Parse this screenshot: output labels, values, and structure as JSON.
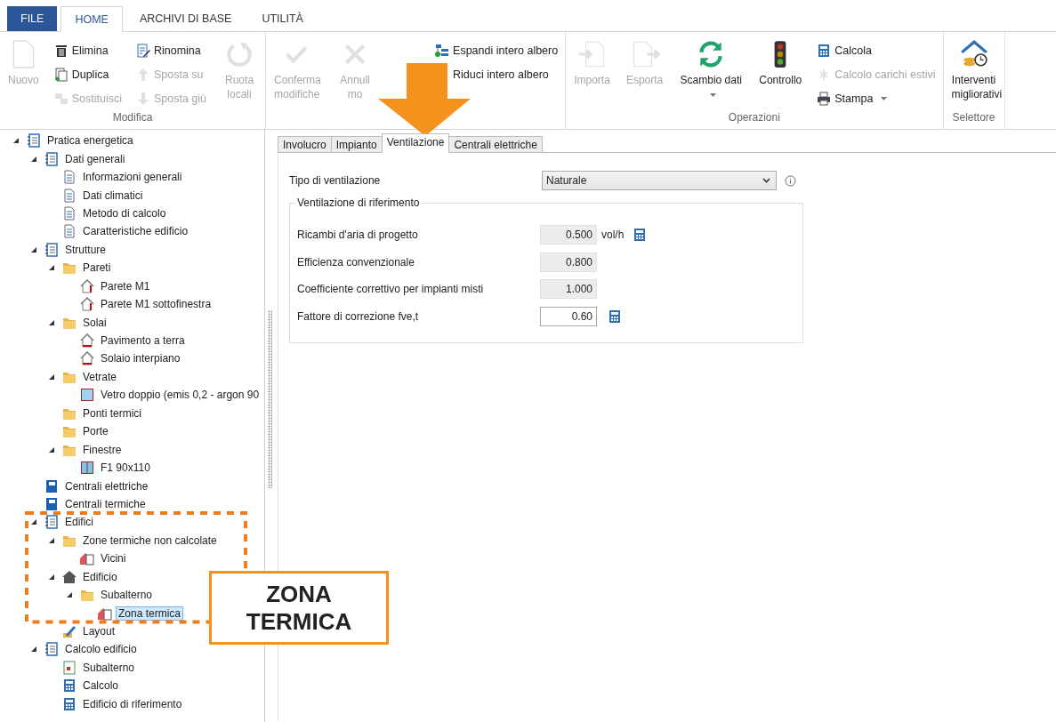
{
  "ribbon": {
    "tabs": [
      {
        "label": "FILE",
        "kind": "file",
        "selected": false
      },
      {
        "label": "HOME",
        "kind": "tab",
        "selected": true
      },
      {
        "label": "ARCHIVI DI BASE",
        "kind": "tab",
        "selected": false
      },
      {
        "label": "UTILITÀ",
        "kind": "tab",
        "selected": false
      }
    ],
    "groups": [
      {
        "label": "Modifica",
        "controls": [
          {
            "label": "Nuovo",
            "kind": "page",
            "disabled": true
          },
          {
            "stack": [
              {
                "label": "Elimina",
                "kind": "trash",
                "disabled": false
              },
              {
                "label": "Duplica",
                "kind": "copy",
                "disabled": false
              },
              {
                "label": "Sostituisci",
                "kind": "swap",
                "disabled": true
              }
            ]
          },
          {
            "stack": [
              {
                "label": "Rinomina",
                "kind": "rename",
                "disabled": false
              },
              {
                "label": "Sposta su",
                "kind": "up",
                "disabled": true
              },
              {
                "label": "Sposta giù",
                "kind": "down",
                "disabled": true
              }
            ]
          },
          {
            "label": "Ruota locali",
            "kind": "rotate",
            "disabled": true
          }
        ]
      },
      {
        "controls": [
          {
            "label": "Conferma modifiche",
            "kind": "check",
            "disabled": true
          },
          {
            "label": "Annull mo",
            "kind": "cross",
            "disabled": true
          },
          {
            "stack": [
              {
                "label": "Espandi intero albero",
                "kind": "tree",
                "disabled": false
              },
              {
                "label": "Riduci intero albero",
                "kind": "none",
                "disabled": false
              }
            ]
          }
        ]
      },
      {
        "label": "Operazioni",
        "controls": [
          {
            "label": "Importa",
            "kind": "import",
            "disabled": true
          },
          {
            "label": "Esporta",
            "kind": "export",
            "disabled": true
          },
          {
            "label": "Scambio dati",
            "kind": "sync",
            "disabled": false,
            "dropdown": true
          },
          {
            "label": "Controllo",
            "kind": "traffic",
            "disabled": false
          },
          {
            "stack": [
              {
                "label": "Calcola",
                "kind": "calc",
                "disabled": false
              },
              {
                "label": "Calcolo carichi estivi",
                "kind": "fan",
                "disabled": true
              },
              {
                "label": "Stampa",
                "kind": "printer",
                "disabled": false,
                "dropdown": true
              }
            ]
          }
        ]
      },
      {
        "label": "Selettore",
        "controls": [
          {
            "label": "Interventi migliorativi",
            "kind": "houseclock",
            "disabled": false
          }
        ]
      }
    ]
  },
  "tree": {
    "items": [
      {
        "label": "Pratica energetica",
        "kind": "notebook",
        "expanded": true,
        "selected": false,
        "children": [
          {
            "label": "Dati generali",
            "kind": "notebook",
            "expanded": true,
            "selected": false,
            "children": [
              {
                "label": "Informazioni generali",
                "kind": "doc",
                "selected": false
              },
              {
                "label": "Dati climatici",
                "kind": "doc",
                "selected": false
              },
              {
                "label": "Metodo di calcolo",
                "kind": "doc",
                "selected": false
              },
              {
                "label": "Caratteristiche edificio",
                "kind": "doc",
                "selected": false
              }
            ]
          },
          {
            "label": "Strutture",
            "kind": "notebook",
            "expanded": true,
            "selected": false,
            "children": [
              {
                "label": "Pareti",
                "kind": "folder",
                "expanded": true,
                "selected": false,
                "children": [
                  {
                    "label": "Parete M1",
                    "kind": "wall",
                    "selected": false
                  },
                  {
                    "label": "Parete M1 sottofinestra",
                    "kind": "wall",
                    "selected": false
                  }
                ]
              },
              {
                "label": "Solai",
                "kind": "folder",
                "expanded": true,
                "selected": false,
                "children": [
                  {
                    "label": "Pavimento a terra",
                    "kind": "floor",
                    "selected": false
                  },
                  {
                    "label": "Solaio interpiano",
                    "kind": "floor",
                    "selected": false
                  }
                ]
              },
              {
                "label": "Vetrate",
                "kind": "folder",
                "expanded": true,
                "selected": false,
                "children": [
                  {
                    "label": "Vetro doppio (emis 0,2 - argon 90",
                    "kind": "glass",
                    "selected": false
                  }
                ]
              },
              {
                "label": "Ponti termici",
                "kind": "folder",
                "selected": false
              },
              {
                "label": "Porte",
                "kind": "folder",
                "selected": false
              },
              {
                "label": "Finestre",
                "kind": "folder",
                "expanded": true,
                "selected": false,
                "children": [
                  {
                    "label": "F1 90x110",
                    "kind": "window",
                    "selected": false
                  }
                ]
              }
            ]
          },
          {
            "label": "Centrali elettriche",
            "kind": "panel",
            "selected": false
          },
          {
            "label": "Centrali termiche",
            "kind": "panel",
            "selected": false
          },
          {
            "label": "Edifici",
            "kind": "notebook",
            "expanded": true,
            "selected": false,
            "children": [
              {
                "label": "Zone termiche non calcolate",
                "kind": "folder",
                "expanded": true,
                "selected": false,
                "children": [
                  {
                    "label": "Vicini",
                    "kind": "zone",
                    "selected": false
                  }
                ]
              },
              {
                "label": "Edificio",
                "kind": "home",
                "expanded": true,
                "selected": false,
                "children": [
                  {
                    "label": "Subalterno",
                    "kind": "folder",
                    "expanded": true,
                    "selected": false,
                    "children": [
                      {
                        "label": "Zona termica",
                        "kind": "zone",
                        "selected": true
                      }
                    ]
                  }
                ]
              },
              {
                "label": "Layout",
                "kind": "pencil",
                "selected": false
              }
            ]
          },
          {
            "label": "Calcolo edificio",
            "kind": "notebook",
            "expanded": true,
            "selected": false,
            "children": [
              {
                "label": "Subalterno",
                "kind": "form",
                "selected": false
              },
              {
                "label": "Calcolo",
                "kind": "calc",
                "selected": false
              },
              {
                "label": "Edificio di riferimento",
                "kind": "calc",
                "selected": false
              }
            ]
          }
        ]
      }
    ]
  },
  "content": {
    "tabs": [
      {
        "label": "Involucro",
        "selected": false
      },
      {
        "label": "Impianto",
        "selected": false
      },
      {
        "label": "Ventilazione",
        "selected": true
      },
      {
        "label": "Centrali elettriche",
        "selected": false
      }
    ],
    "type_field": {
      "label": "Tipo di ventilazione",
      "value": "Naturale"
    },
    "group": {
      "title": "Ventilazione di riferimento",
      "rows": [
        {
          "label": "Ricambi d'aria di progetto",
          "value": "0.500",
          "unit": "vol/h",
          "readonly": true,
          "calculator": true
        },
        {
          "label": "Efficienza convenzionale",
          "value": "0.800",
          "readonly": true,
          "calculator": false
        },
        {
          "label": "Coefficiente correttivo per impianti misti",
          "value": "1.000",
          "readonly": true,
          "calculator": false
        },
        {
          "label": "Fattore di correzione fve,t",
          "value": "0.60",
          "readonly": false,
          "calculator": true
        }
      ]
    }
  },
  "annotation": {
    "callout": "ZONA TERMICA"
  }
}
